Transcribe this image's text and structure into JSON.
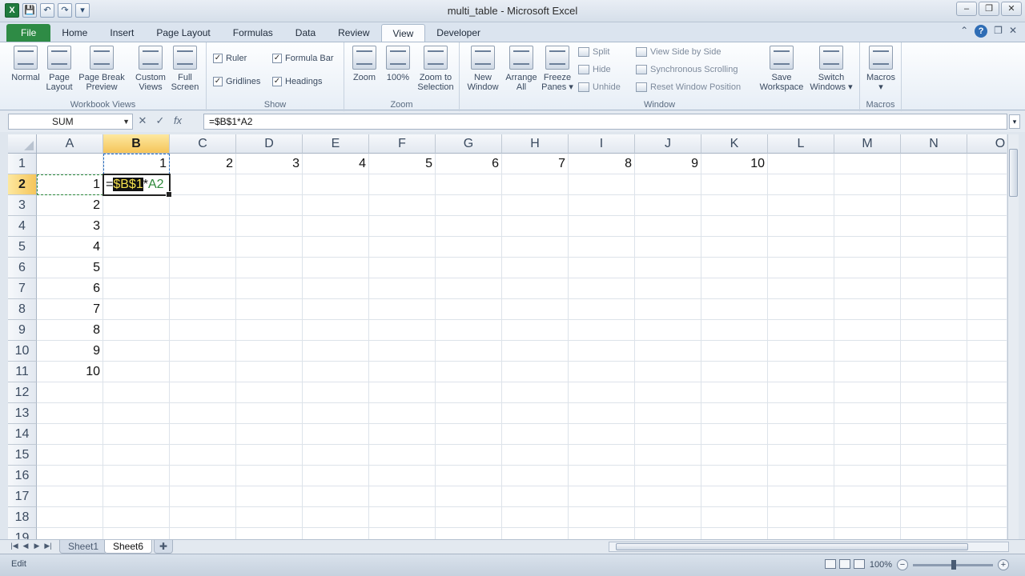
{
  "window": {
    "title": "multi_table  -  Microsoft Excel",
    "app_icon": "X",
    "controls": [
      "–",
      "❐",
      "✕"
    ]
  },
  "qat": {
    "save": "💾",
    "undo": "↶",
    "redo": "↷",
    "more": "▾"
  },
  "tabs": [
    "File",
    "Home",
    "Insert",
    "Page Layout",
    "Formulas",
    "Data",
    "Review",
    "View",
    "Developer"
  ],
  "active_tab": "View",
  "ribbon": {
    "workbook_views": {
      "label": "Workbook Views",
      "normal": "Normal",
      "page_layout": "Page\nLayout",
      "page_break": "Page Break\nPreview",
      "custom_views": "Custom\nViews",
      "full_screen": "Full\nScreen"
    },
    "show": {
      "label": "Show",
      "ruler": "Ruler",
      "formula_bar": "Formula Bar",
      "gridlines": "Gridlines",
      "headings": "Headings"
    },
    "zoom": {
      "label": "Zoom",
      "zoom": "Zoom",
      "hundred": "100%",
      "zoom_selection": "Zoom to\nSelection"
    },
    "window": {
      "label": "Window",
      "new_window": "New\nWindow",
      "arrange_all": "Arrange\nAll",
      "freeze_panes": "Freeze\nPanes ▾",
      "split": "Split",
      "hide": "Hide",
      "unhide": "Unhide",
      "side_by_side": "View Side by Side",
      "sync_scroll": "Synchronous Scrolling",
      "reset_pos": "Reset Window Position",
      "save_workspace": "Save\nWorkspace",
      "switch_windows": "Switch\nWindows ▾"
    },
    "macros": {
      "label": "Macros",
      "macros": "Macros\n▾"
    }
  },
  "formula_bar": {
    "name_box": "SUM",
    "cancel": "✕",
    "enter": "✓",
    "fx": "fx",
    "formula": "=$B$1*A2"
  },
  "columns": [
    "A",
    "B",
    "C",
    "D",
    "E",
    "F",
    "G",
    "H",
    "I",
    "J",
    "K",
    "L",
    "M",
    "N",
    "O"
  ],
  "rows": [
    "1",
    "2",
    "3",
    "4",
    "5",
    "6",
    "7",
    "8",
    "9",
    "10",
    "11",
    "12",
    "13",
    "14",
    "15",
    "16",
    "17",
    "18",
    "19"
  ],
  "row1_values": [
    "",
    "1",
    "2",
    "3",
    "4",
    "5",
    "6",
    "7",
    "8",
    "9",
    "10"
  ],
  "colA_values": [
    "1",
    "2",
    "3",
    "4",
    "5",
    "6",
    "7",
    "8",
    "9",
    "10"
  ],
  "edit_cell": {
    "eq": "=",
    "ref": "$B$1",
    "op": "*",
    "ref2": "A2"
  },
  "sheets": [
    "Sheet1",
    "Sheet6"
  ],
  "active_sheet": "Sheet6",
  "status": {
    "mode": "Edit",
    "zoom": "100%"
  }
}
